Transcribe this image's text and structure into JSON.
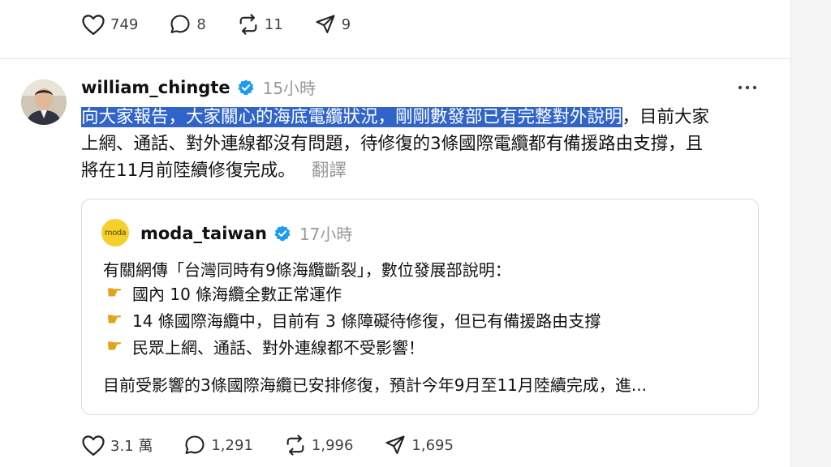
{
  "top_actions": {
    "likes": "749",
    "comments": "8",
    "reposts": "11",
    "shares": "9"
  },
  "post": {
    "username": "william_chingte",
    "time": "15小時",
    "text_highlighted": "向大家報告，大家關心的海底電纜狀況，剛剛數發部已有完整對外說明",
    "text_line1_rest": "，目前大家",
    "text_line2": "上網、通話、對外連線都沒有問題，待修復的3條國際電纜都有備援路由支撐，且",
    "text_line3": "將在11月前陸續修復完成。",
    "translate_label": "翻譯"
  },
  "quote": {
    "avatar_text": "moda",
    "username": "moda_taiwan",
    "time": "17小時",
    "line1": "有關網傳「台灣同時有9條海纜斷裂」，數位發展部說明：",
    "bullets": [
      "國內 10 條海纜全數正常運作",
      "14 條國際海纜中，目前有 3 條障礙待修復，但已有備援路由支撐",
      "民眾上網、通話、對外連線都不受影響！"
    ],
    "line_last": "目前受影響的3條國際海纜已安排修復，預計今年9月至11月陸續完成，進..."
  },
  "bottom_actions": {
    "likes": "3.1 萬",
    "comments": "1,291",
    "reposts": "1,996",
    "shares": "1,695"
  },
  "colors": {
    "highlight": "#3064c9",
    "verified": "#1d9bf0",
    "moda_yellow": "#f5cf2c",
    "muted": "#999999"
  },
  "icons": {
    "like": "heart-icon",
    "comment": "comment-bubble-icon",
    "repost": "repost-icon",
    "share": "send-icon",
    "more": "more-dots-icon",
    "pointing": "pointing-hand-icon"
  }
}
